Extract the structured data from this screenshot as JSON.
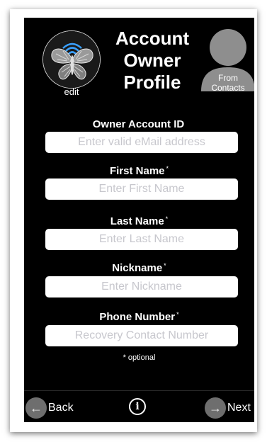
{
  "header": {
    "title_line1": "Account",
    "title_line2": "Owner",
    "title_line3": "Profile",
    "edit_label": "edit",
    "contacts_line1": "From",
    "contacts_line2": "Contacts"
  },
  "form": {
    "fields": [
      {
        "label": "Owner Account ID",
        "required_mark": "",
        "placeholder": "Enter valid eMail address",
        "value": ""
      },
      {
        "label": "First Name",
        "required_mark": "*",
        "placeholder": "Enter First Name",
        "value": ""
      },
      {
        "label": "Last Name",
        "required_mark": "*",
        "placeholder": "Enter Last Name",
        "value": ""
      },
      {
        "label": "Nickname",
        "required_mark": "*",
        "placeholder": "Enter Nickname",
        "value": ""
      },
      {
        "label": "Phone Number",
        "required_mark": "*",
        "placeholder": "Recovery Contact Number",
        "value": ""
      }
    ],
    "optional_note": "* optional"
  },
  "footer": {
    "back_label": "Back",
    "next_label": "Next",
    "info_glyph": "i",
    "back_icon": "left-arrow-icon",
    "next_icon": "right-arrow-icon"
  },
  "colors": {
    "background": "#000000",
    "text": "#ffffff",
    "input_bg": "#ffffff",
    "placeholder": "#c7c7cd",
    "nav_circle": "#6e6e6e"
  }
}
